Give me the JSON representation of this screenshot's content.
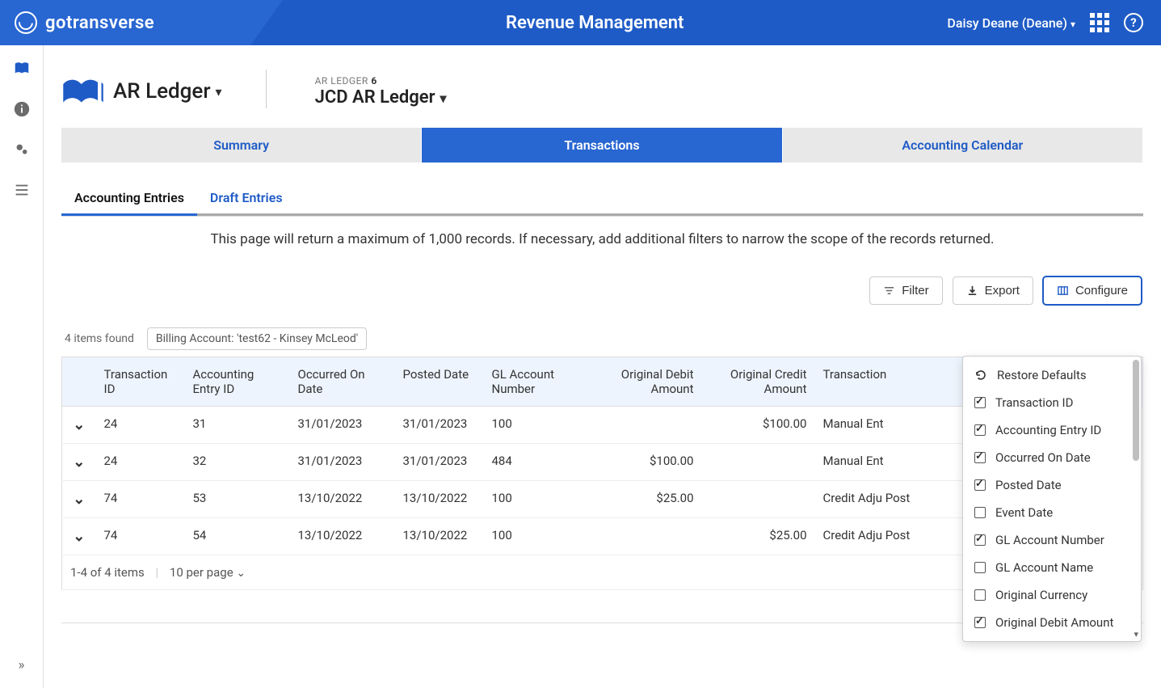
{
  "header": {
    "logo": "gotransverse",
    "title": "Revenue Management",
    "user": "Daisy Deane (Deane)"
  },
  "breadcrumb": {
    "ledger_label": "AR Ledger",
    "sub_prefix": "AR LEDGER",
    "sub_id": "6",
    "sub_title": "JCD AR Ledger"
  },
  "tabs_primary": [
    {
      "label": "Summary",
      "active": false
    },
    {
      "label": "Transactions",
      "active": true
    },
    {
      "label": "Accounting Calendar",
      "active": false
    }
  ],
  "subtabs": [
    {
      "label": "Accounting Entries",
      "active": true
    },
    {
      "label": "Draft Entries",
      "active": false
    }
  ],
  "notice": "This page will return a maximum of 1,000 records. If necessary, add additional filters to narrow the scope of the records returned.",
  "toolbar": {
    "filter": "Filter",
    "export": "Export",
    "configure": "Configure"
  },
  "meta": {
    "count": "4 items found",
    "chip": "Billing Account: 'test62 - Kinsey McLeod'"
  },
  "columns": {
    "c1": "Transaction ID",
    "c2": "Accounting Entry ID",
    "c3": "Occurred On Date",
    "c4": "Posted Date",
    "c5": "GL Account Number",
    "c6": "Original Debit Amount",
    "c7": "Original Credit Amount",
    "c8": "Transaction"
  },
  "rows": [
    {
      "txid": "24",
      "aeid": "31",
      "occ": "31/01/2023",
      "post": "31/01/2023",
      "gl": "100",
      "debit": "",
      "credit": "$100.00",
      "tx": "Manual Ent"
    },
    {
      "txid": "24",
      "aeid": "32",
      "occ": "31/01/2023",
      "post": "31/01/2023",
      "gl": "484",
      "debit": "$100.00",
      "credit": "",
      "tx": "Manual Ent"
    },
    {
      "txid": "74",
      "aeid": "53",
      "occ": "13/10/2022",
      "post": "13/10/2022",
      "gl": "100",
      "debit": "$25.00",
      "credit": "",
      "tx": "Credit Adju Post"
    },
    {
      "txid": "74",
      "aeid": "54",
      "occ": "13/10/2022",
      "post": "13/10/2022",
      "gl": "100",
      "debit": "",
      "credit": "$25.00",
      "tx": "Credit Adju Post"
    }
  ],
  "footer": {
    "range": "1-4 of 4 items",
    "perpage": "10 per page"
  },
  "configure_menu": [
    {
      "label": "Restore Defaults",
      "type": "action"
    },
    {
      "label": "Transaction ID",
      "type": "check",
      "checked": true
    },
    {
      "label": "Accounting Entry ID",
      "type": "check",
      "checked": true
    },
    {
      "label": "Occurred On Date",
      "type": "check",
      "checked": true
    },
    {
      "label": "Posted Date",
      "type": "check",
      "checked": true
    },
    {
      "label": "Event Date",
      "type": "check",
      "checked": false
    },
    {
      "label": "GL Account Number",
      "type": "check",
      "checked": true
    },
    {
      "label": "GL Account Name",
      "type": "check",
      "checked": false
    },
    {
      "label": "Original Currency",
      "type": "check",
      "checked": false
    },
    {
      "label": "Original Debit Amount",
      "type": "check",
      "checked": true
    }
  ]
}
